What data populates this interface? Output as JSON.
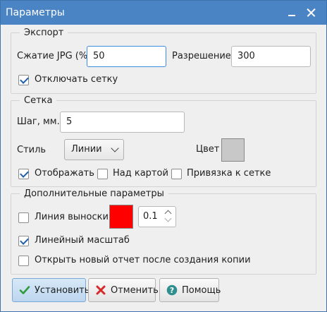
{
  "window": {
    "title": "Параметры"
  },
  "export": {
    "legend": "Экспорт",
    "jpg_label": "Сжатие JPG (%)",
    "jpg_value": "50",
    "resolution_label": "Разрешение",
    "resolution_value": "300",
    "disable_grid_label": "Отключать сетку",
    "disable_grid_checked": true
  },
  "grid": {
    "legend": "Сетка",
    "step_label": "Шаг, мм.",
    "step_value": "5",
    "style_label": "Стиль",
    "style_value": "Линии",
    "color_label": "Цвет",
    "color_value": "#c8c8c8",
    "show_label": "Отображать",
    "show_checked": true,
    "over_map_label": "Над картой",
    "over_map_checked": false,
    "snap_label": "Привязка к сетке",
    "snap_checked": false
  },
  "extra": {
    "legend": "Дополнительные параметры",
    "leader_label": "Линия выноски",
    "leader_checked": false,
    "leader_color": "#ff0000",
    "leader_width": "0.1",
    "linear_scale_label": "Линейный масштаб",
    "linear_scale_checked": true,
    "open_report_label": "Открыть новый отчет после создания копии",
    "open_report_checked": false
  },
  "buttons": {
    "apply": "Установить",
    "cancel": "Отменить",
    "help": "Помощь"
  },
  "icons": {
    "apply": "checkmark-icon",
    "cancel": "x-cross-icon",
    "help": "question-icon"
  },
  "colors": {
    "titlebar": "#4a84c4",
    "accent": "#1e5fa8",
    "apply_icon": "#2f9a3a",
    "cancel_icon": "#d42a2a",
    "help_icon": "#2f8f8f"
  }
}
